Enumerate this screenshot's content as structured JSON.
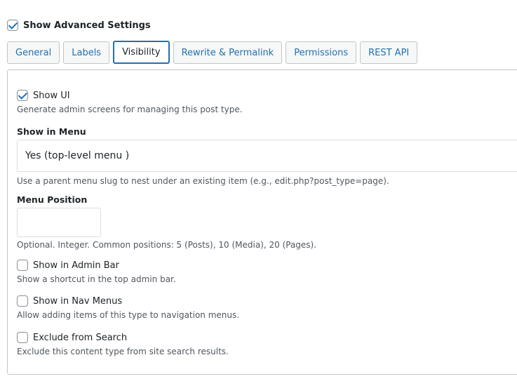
{
  "advanced": {
    "label": "Show Advanced Settings",
    "checked": true
  },
  "tabs": [
    {
      "label": "General",
      "active": false
    },
    {
      "label": "Labels",
      "active": false
    },
    {
      "label": "Visibility",
      "active": true
    },
    {
      "label": "Rewrite & Permalink",
      "active": false
    },
    {
      "label": "Permissions",
      "active": false
    },
    {
      "label": "REST API",
      "active": false
    }
  ],
  "visibility": {
    "show_ui": {
      "label": "Show UI",
      "checked": true,
      "help": "Generate admin screens for managing this post type."
    },
    "show_in_menu": {
      "title": "Show in Menu",
      "value": "Yes (top-level menu )",
      "help": "Use a parent menu slug to nest under an existing item (e.g., edit.php?post_type=page)."
    },
    "menu_position": {
      "title": "Menu Position",
      "value": "",
      "help": "Optional. Integer. Common positions: 5 (Posts), 10 (Media), 20 (Pages)."
    },
    "show_in_admin_bar": {
      "label": "Show in Admin Bar",
      "checked": false,
      "help": "Show a shortcut in the top admin bar."
    },
    "show_in_nav_menus": {
      "label": "Show in Nav Menus",
      "checked": false,
      "help": "Allow adding items of this type to navigation menus."
    },
    "exclude_from_search": {
      "label": "Exclude from Search",
      "checked": false,
      "help": "Exclude this content type from site search results."
    }
  },
  "colors": {
    "accent": "#2271b1",
    "border": "#c3c4c7",
    "text": "#1d2327",
    "help_text": "#50575e"
  }
}
